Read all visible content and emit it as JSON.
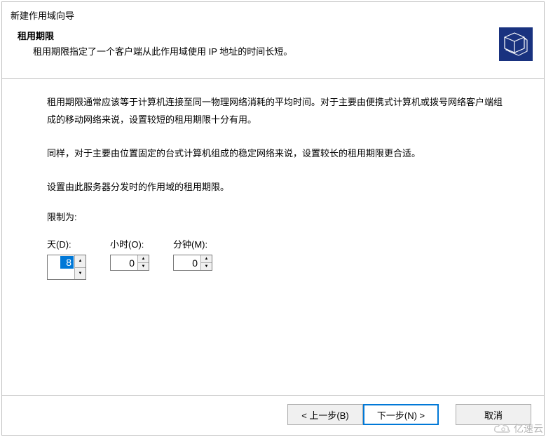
{
  "window": {
    "title": "新建作用域向导"
  },
  "header": {
    "title": "租用期限",
    "subtitle": "租用期限指定了一个客户端从此作用域使用 IP 地址的时间长短。"
  },
  "content": {
    "para1": "租用期限通常应该等于计算机连接至同一物理网络消耗的平均时间。对于主要由便携式计算机或拨号网络客户端组成的移动网络来说，设置较短的租用期限十分有用。",
    "para2": "同样，对于主要由位置固定的台式计算机组成的稳定网络来说，设置较长的租用期限更合适。",
    "set_label": "设置由此服务器分发时的作用域的租用期限。",
    "limit_label": "限制为:",
    "days": {
      "label": "天(D):",
      "value": "8"
    },
    "hours": {
      "label": "小时(O):",
      "value": "0"
    },
    "minutes": {
      "label": "分钟(M):",
      "value": "0"
    }
  },
  "footer": {
    "back": "< 上一步(B)",
    "next": "下一步(N) >",
    "cancel": "取消"
  },
  "watermark": {
    "text": "亿速云"
  }
}
